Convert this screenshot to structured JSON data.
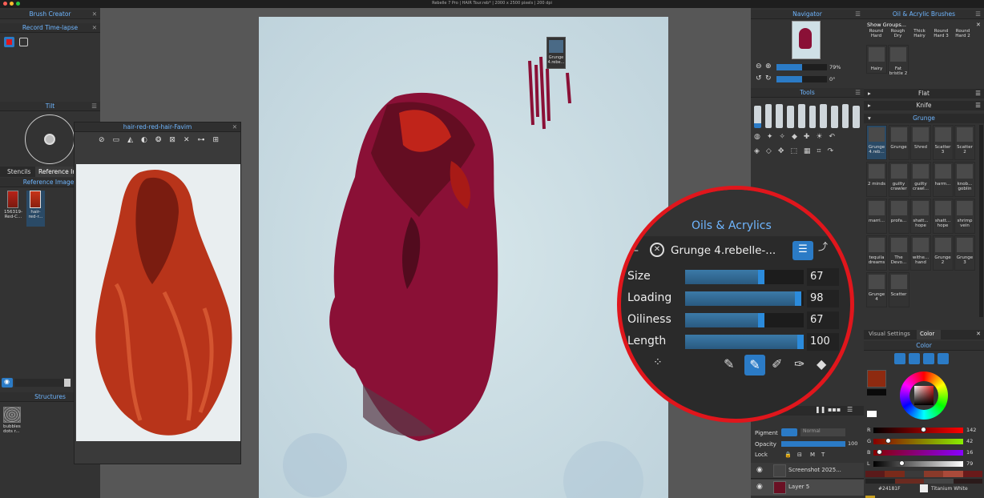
{
  "window": {
    "title": "Rebelle 7 Pro | HAIR Tour.reb* | 2000 x 2500 pixels | 200 dpi"
  },
  "brush_creator": {
    "title": "Brush Creator"
  },
  "timelapse": {
    "title": "Record Time-lapse"
  },
  "tilt": {
    "title": "Tilt"
  },
  "tabs_left": {
    "stencils": "Stencils",
    "reference": "Reference Im"
  },
  "reference_images": {
    "title": "Reference Images",
    "items": [
      {
        "label": "156319-Red-C..."
      },
      {
        "label": "hair-red-r..."
      }
    ]
  },
  "structures": {
    "title": "Structures",
    "items": [
      {
        "label": "bubbles dots r..."
      }
    ]
  },
  "ref_window": {
    "title": "hair-red-red-hair-Favim"
  },
  "navigator": {
    "title": "Navigator",
    "zoom": "79%",
    "rotation": "0°"
  },
  "tools": {
    "title": "Tools"
  },
  "brushes": {
    "title": "Oil & Acrylic Brushes",
    "show_groups": "Show Groups...",
    "top_row": [
      "Round Hard",
      "Rough Dry",
      "Thick Hairy",
      "Round Hard 3",
      "Round Hard 2"
    ],
    "second_row": [
      "Hairy",
      "Fat bristle 2"
    ],
    "groups": [
      "Flat",
      "Knife",
      "Grunge"
    ],
    "grunge_rows": [
      [
        "Grunge 4.reb...",
        "Grunge",
        "Shred",
        "Scatter 3",
        "Scatter 2"
      ],
      [
        "2 minds",
        "guilty crawler",
        "guilty crawl...",
        "harm...",
        "knob... goblin"
      ],
      [
        "marri...",
        "profa...",
        "shatt... hope",
        "shatt... hope",
        "shrimp vein"
      ],
      [
        "tequila dreams",
        "The Devo...",
        "withe... hand",
        "Grunge 2",
        "Grunge 3"
      ],
      [
        "Grunge 4",
        "Scatter"
      ]
    ]
  },
  "oils_popup": {
    "title": "Oils & Acrylics",
    "brush_name": "Grunge 4.rebelle-...",
    "params": [
      {
        "label": "Size",
        "value": "67",
        "level": 0.67
      },
      {
        "label": "Loading",
        "value": "98",
        "level": 0.98
      },
      {
        "label": "Oiliness",
        "value": "67",
        "level": 0.67
      },
      {
        "label": "Length",
        "value": "100",
        "level": 1.0
      }
    ]
  },
  "tooltip": {
    "label": "Grunge 4.rebe..."
  },
  "color_panel": {
    "tabs": [
      "Visual Settings",
      "Color"
    ],
    "title": "Color",
    "rgb": [
      {
        "ch": "R",
        "v": "142",
        "level": 0.557
      },
      {
        "ch": "G",
        "v": "42",
        "level": 0.165
      },
      {
        "ch": "B",
        "v": "16",
        "level": 0.063
      },
      {
        "ch": "L",
        "v": "79",
        "level": 0.31
      }
    ],
    "hex": "#24181F",
    "swatch_name": "Titanium White",
    "current_color": "#8e2a10"
  },
  "layers": {
    "pigment_label": "Pigment",
    "blend": "Normal",
    "opacity_label": "Opacity",
    "opacity_value": "100",
    "lock_label": "Lock",
    "lock_opts": [
      "M",
      "T"
    ],
    "items": [
      {
        "name": "Screenshot 2025..."
      },
      {
        "name": "Layer 5"
      }
    ]
  },
  "colors": {
    "accent": "#2b7bc6",
    "header_text": "#6fb6ff",
    "ring": "#e0161c",
    "paint": "#8a1036"
  }
}
